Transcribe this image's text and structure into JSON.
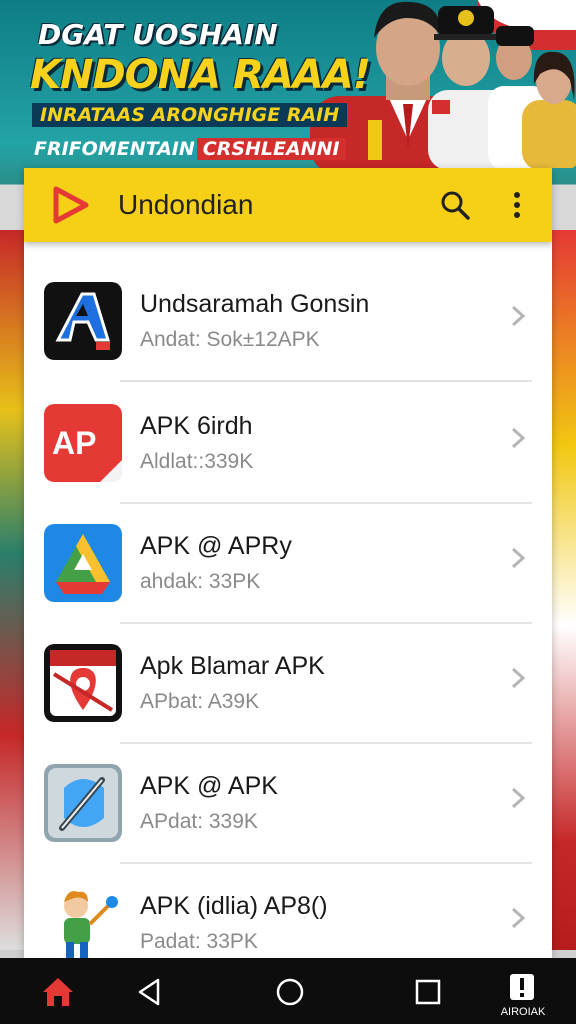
{
  "banner": {
    "line1": "DGAT UOSHAIN",
    "line2": "KNDONA RAAA!",
    "line3": "INRATAAS ARONGHIGE RAIH",
    "line4_a": "FRIFOMENTAIN",
    "line4_b": "CRSHLEANNI"
  },
  "appbar": {
    "title": "Undondian",
    "logo_icon": "play-logo-icon",
    "search_icon": "search-icon",
    "more_icon": "more-vertical-icon",
    "color": "#f6cf17"
  },
  "apps": [
    {
      "name": "Undsaramah Gonsin",
      "sub": "Andat: Sok±12APK",
      "icon": "a-arrow-app-icon"
    },
    {
      "name": "APK 6irdh",
      "sub": "Aldlat::339K",
      "icon": "ap-red-app-icon"
    },
    {
      "name": "APK @ APRy",
      "sub": "ahdak: 33PK",
      "icon": "drive-triangle-app-icon"
    },
    {
      "name": "Apk Blamar APK",
      "sub": "APbat: A39K",
      "icon": "map-pin-app-icon"
    },
    {
      "name": "APK @ APK",
      "sub": "APdat: 339K",
      "icon": "pen-app-icon"
    },
    {
      "name": "APK (idlia) AP8()",
      "sub": "Padat: 33PK",
      "icon": "cartoon-character-app-icon"
    }
  ],
  "navbar": {
    "home_icon": "home-icon",
    "back_icon": "back-triangle-icon",
    "circle_icon": "home-circle-icon",
    "recents_icon": "recents-square-icon",
    "last_icon": "info-icon",
    "last_label": "AIROIAK"
  },
  "colors": {
    "accent": "#f6cf17",
    "nav_home": "#e53935"
  }
}
